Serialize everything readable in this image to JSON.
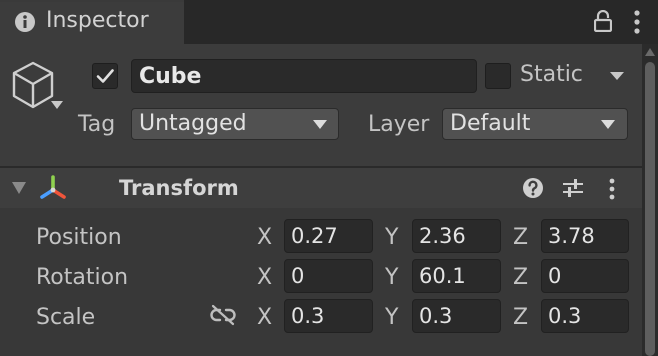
{
  "tab": {
    "title": "Inspector"
  },
  "object": {
    "active": true,
    "name": "Cube",
    "static_label": "Static",
    "static": false,
    "tag_label": "Tag",
    "tag_value": "Untagged",
    "layer_label": "Layer",
    "layer_value": "Default"
  },
  "transform": {
    "title": "Transform",
    "rows": [
      {
        "label": "Position",
        "x": "0.27",
        "y": "2.36",
        "z": "3.78"
      },
      {
        "label": "Rotation",
        "x": "0",
        "y": "60.1",
        "z": "0"
      },
      {
        "label": "Scale",
        "x": "0.3",
        "y": "0.3",
        "z": "0.3"
      }
    ],
    "axes": {
      "x": "X",
      "y": "Y",
      "z": "Z"
    }
  },
  "icons": {
    "tab": "info-icon",
    "lock": "lock-icon",
    "menu": "kebab-menu-icon",
    "object": "cube-icon",
    "transform": "transform-axis-icon",
    "help": "help-icon",
    "presets": "sliders-icon",
    "scale_link": "unlinked-chain-icon"
  },
  "colors": {
    "background": "#383838",
    "tab_strip": "#282828",
    "field": "#2a2a2a",
    "dropdown": "#515151",
    "text": "#c4c4c4"
  }
}
